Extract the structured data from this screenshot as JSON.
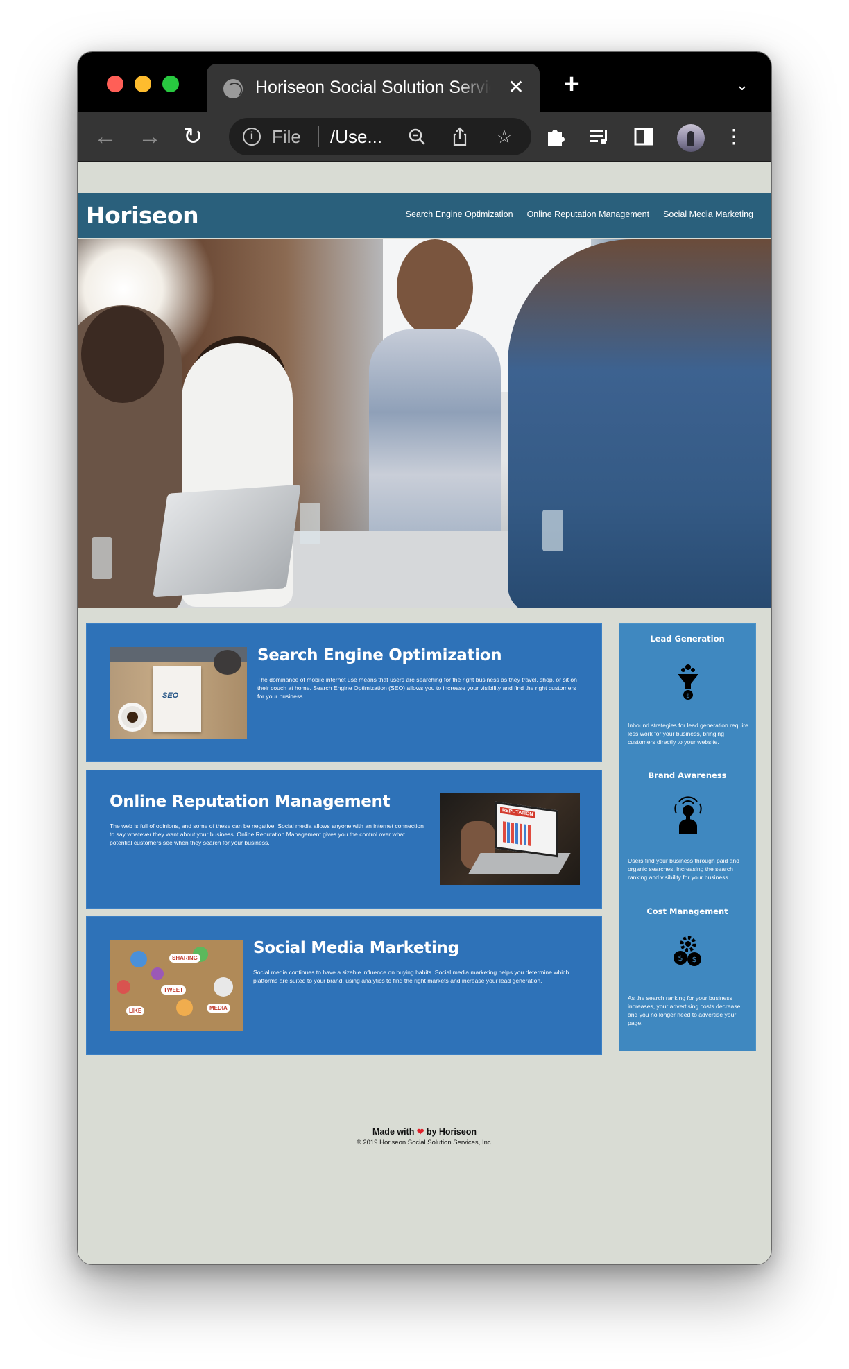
{
  "browser": {
    "tab_title": "Horiseon Social Solution Services",
    "omnibox_scheme": "File",
    "omnibox_path": "/Use...",
    "icons": [
      "globe-icon",
      "close-icon",
      "plus-icon",
      "chevron-down-icon",
      "back-arrow-icon",
      "forward-arrow-icon",
      "reload-icon",
      "info-icon",
      "zoom-icon",
      "share-icon",
      "star-icon",
      "extensions-icon",
      "reading-list-icon",
      "sidebar-icon",
      "profile-avatar",
      "kebab-menu-icon"
    ]
  },
  "header": {
    "logo": "Horiseon",
    "nav": [
      {
        "label": "Search Engine Optimization"
      },
      {
        "label": "Online Reputation Management"
      },
      {
        "label": "Social Media Marketing"
      }
    ]
  },
  "content": [
    {
      "title": "Search Engine Optimization",
      "text": "The dominance of mobile internet use means that users are searching for the right business as they travel, shop, or sit on their couch at home. Search Engine Optimization (SEO) allows you to increase your visibility and find the right customers for your business.",
      "image_label": "SEO"
    },
    {
      "title": "Online Reputation Management",
      "text": "The web is full of opinions, and some of these can be negative. Social media allows anyone with an internet connection to say whatever they want about your business. Online Reputation Management gives you the control over what potential customers see when they search for your business.",
      "image_label": "REPUTATION"
    },
    {
      "title": "Social Media Marketing",
      "text": "Social media continues to have a sizable influence on buying habits. Social media marketing helps you determine which platforms are suited to your brand, using analytics to find the right markets and increase your lead generation.",
      "image_tags": [
        "SHARING",
        "TWEET",
        "LIKE",
        "MEDIA"
      ]
    }
  ],
  "benefits": [
    {
      "title": "Lead Generation",
      "icon": "lead-funnel-icon",
      "text": "Inbound strategies for lead generation require less work for your business, bringing customers directly to your website."
    },
    {
      "title": "Brand Awareness",
      "icon": "brand-lightbulb-icon",
      "text": "Users find your business through paid and organic searches, increasing the search ranking and visibility for your business."
    },
    {
      "title": "Cost Management",
      "icon": "cost-gears-icon",
      "text": "As the search ranking for your business increases, your advertising costs decrease, and you no longer need to advertise your page."
    }
  ],
  "footer": {
    "made_prefix": "Made with",
    "made_suffix": "by Horiseon",
    "copyright": "© 2019 Horiseon Social Solution Services, Inc."
  },
  "colors": {
    "header_bg": "#2a607c",
    "card_bg": "#2e72b8",
    "sidebar_bg": "#3f88c0",
    "page_bg": "#d9dcd4"
  }
}
